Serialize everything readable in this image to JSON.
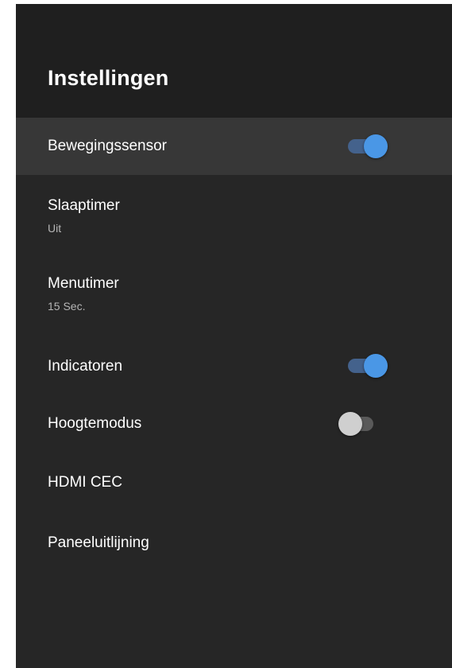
{
  "header": {
    "title": "Instellingen"
  },
  "items": [
    {
      "label": "Bewegingssensor",
      "toggle": "on",
      "selected": true
    },
    {
      "label": "Slaaptimer",
      "sublabel": "Uit"
    },
    {
      "label": "Menutimer",
      "sublabel": "15 Sec."
    },
    {
      "label": "Indicatoren",
      "toggle": "on"
    },
    {
      "label": "Hoogtemodus",
      "toggle": "off"
    },
    {
      "label": "HDMI CEC"
    },
    {
      "label": "Paneeluitlijning"
    }
  ],
  "colors": {
    "toggle_on_thumb": "#4a97e6",
    "toggle_on_track": "#44628c",
    "toggle_off_thumb": "#cfcfcf",
    "toggle_off_track": "#5a5a5a",
    "background": "#262626",
    "selected_row": "#373737"
  }
}
